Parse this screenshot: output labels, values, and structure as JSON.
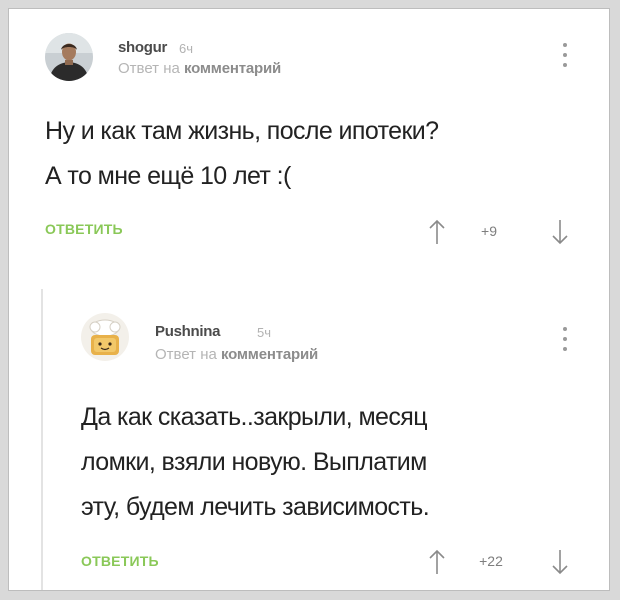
{
  "comments": [
    {
      "username": "shogur",
      "time": "6ч",
      "reply_to_prefix": "Ответ на",
      "reply_to_link": "комментарий",
      "body_lines": [
        "Ну и как там жизнь, после ипотеки?",
        "А то мне ещё 10 лет :("
      ],
      "reply_label": "ОТВЕТИТЬ",
      "rating": "+9",
      "avatar": "man-photo"
    },
    {
      "username": "Pushnina",
      "time": "5ч",
      "reply_to_prefix": "Ответ на",
      "reply_to_link": "комментарий",
      "body_lines": [
        "Да как сказать..закрыли, месяц",
        "ломки, взяли новую. Выплатим",
        "эту, будем лечить зависимость."
      ],
      "reply_label": "ОТВЕТИТЬ",
      "rating": "+22",
      "avatar": "chef-toast-cartoon"
    }
  ],
  "icons": {
    "more": "more-vertical-icon",
    "upvote": "arrow-up-icon",
    "downvote": "arrow-down-icon"
  },
  "colors": {
    "reply_button": "#8ac858",
    "text": "#222222",
    "muted": "#b5b5b5"
  }
}
